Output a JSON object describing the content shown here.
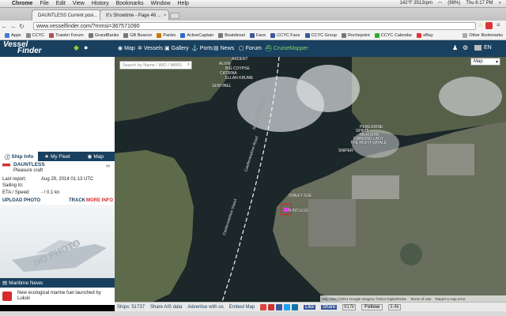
{
  "mac_menu": {
    "items": [
      "Chrome",
      "File",
      "Edit",
      "View",
      "History",
      "Bookmarks",
      "Window",
      "Help"
    ],
    "clock": "Thu 6:17 PM",
    "battery": "(98%)",
    "stats": "142°F 3513rpm"
  },
  "tabs": [
    {
      "title": "DAUNTLESS Current posi...",
      "active": true
    },
    {
      "title": "It's Showtime - Page 46 ...",
      "active": false
    }
  ],
  "url": "www.vesselfinder.com/?mmsi=367571090",
  "bookmarks": [
    "Apps",
    "CCYC",
    "Trawler Forum",
    "GrandBanks",
    "GB Beacon",
    "Panbo",
    "ActiveCaptain",
    "Boatdiesel",
    "Face",
    "CCYC Face",
    "CCYC Group",
    "Rochepoint",
    "CCYC Calendar",
    "eBay"
  ],
  "other_bookmarks": "Other Bookmarks",
  "site": {
    "logo_top": "Vessel",
    "logo_bottom": "Finder",
    "nav": [
      "Map",
      "Vessels",
      "Gallery",
      "Ports",
      "News",
      "Forum",
      "CruiseMapper"
    ],
    "lang": "EN",
    "map_type": "Map"
  },
  "search": {
    "placeholder": "Search by Name / IMO / MMSI"
  },
  "panel": {
    "tabs": [
      "Ship Info",
      "My Fleet",
      "Map"
    ],
    "ship_name": "DAUNTLESS",
    "ship_type": "Pleasure craft",
    "fields": [
      {
        "label": "Last report:",
        "value": "Aug 29, 2014 01:13 UTC"
      },
      {
        "label": "Sailing to:",
        "value": ""
      },
      {
        "label": "ETA / Speed:",
        "value": "- / 0.1 kn"
      }
    ],
    "upload_photo": "UPLOAD PHOTO",
    "track": "TRACK",
    "more_info": "MORE INFO",
    "no_photo": "NO PHOTO",
    "maritime_news": "Maritime News",
    "news_item": "New ecological marine fuel launched by Lukoil"
  },
  "map_labels": {
    "vessels": [
      "ARDENT",
      "ALVIN",
      "BIG COYPSE",
      "CATRINA",
      "ELLAN KRUME",
      "SENTINEL",
      "PEREGRINE",
      "SPIRIT",
      "MERIDIAN",
      "DIAMOND LADY",
      "THE RIGHT WHALE",
      "SNIPER",
      "SWEET SUE",
      "DAUNTLESS"
    ],
    "street_names": [
      "Jacobs Hole Road",
      "Castleviewhive Road",
      "Castleviewhive Island"
    ],
    "attribution": "Map data ©2014 Google Imagery ©2014 DigitalGlobe",
    "terms": "Terms of Use",
    "report": "Report a map error"
  },
  "bottom": {
    "ships": "Ships: 51737",
    "share_ais": "Share AIS data",
    "advertise": "Advertise with us",
    "embed": "Embed Map",
    "like": "Like",
    "share": "Share",
    "share_count": "917k",
    "follow": "Follow",
    "follow_count": "3.4k"
  },
  "colors": {
    "brand": "#19405f",
    "accent_red": "#d62b2b",
    "water": "#1c2729",
    "land": "#556046"
  }
}
